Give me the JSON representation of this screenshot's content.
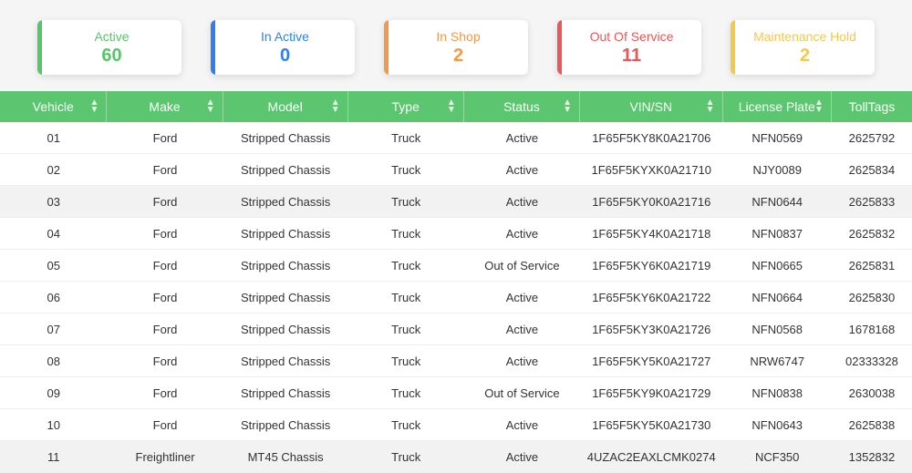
{
  "cards": [
    {
      "label": "Active",
      "value": "60",
      "colorClass": "c-green",
      "barClass": "b-green"
    },
    {
      "label": "In Active",
      "value": "0",
      "colorClass": "c-blue",
      "barClass": "b-blue"
    },
    {
      "label": "In Shop",
      "value": "2",
      "colorClass": "c-orange",
      "barClass": "b-orange"
    },
    {
      "label": "Out Of Service",
      "value": "11",
      "colorClass": "c-red",
      "barClass": "b-red"
    },
    {
      "label": "Maintenance Hold",
      "value": "2",
      "colorClass": "c-yellow",
      "barClass": "b-yellow"
    }
  ],
  "columns": [
    {
      "label": "Vehicle",
      "class": "col-vehicle"
    },
    {
      "label": "Make",
      "class": "col-make"
    },
    {
      "label": "Model",
      "class": "col-model"
    },
    {
      "label": "Type",
      "class": "col-type"
    },
    {
      "label": "Status",
      "class": "col-status"
    },
    {
      "label": "VIN/SN",
      "class": "col-vin"
    },
    {
      "label": "License Plate",
      "class": "col-plate"
    },
    {
      "label": "TollTags",
      "class": "col-toll"
    }
  ],
  "rows": [
    {
      "vehicle": "01",
      "make": "Ford",
      "model": "Stripped Chassis",
      "type": "Truck",
      "status": "Active",
      "vin": "1F65F5KY8K0A21706",
      "plate": "NFN0569",
      "toll": "2625792",
      "alt": false
    },
    {
      "vehicle": "02",
      "make": "Ford",
      "model": "Stripped Chassis",
      "type": "Truck",
      "status": "Active",
      "vin": "1F65F5KYXK0A21710",
      "plate": "NJY0089",
      "toll": "2625834",
      "alt": false
    },
    {
      "vehicle": "03",
      "make": "Ford",
      "model": "Stripped Chassis",
      "type": "Truck",
      "status": "Active",
      "vin": "1F65F5KY0K0A21716",
      "plate": "NFN0644",
      "toll": "2625833",
      "alt": true
    },
    {
      "vehicle": "04",
      "make": "Ford",
      "model": "Stripped Chassis",
      "type": "Truck",
      "status": "Active",
      "vin": "1F65F5KY4K0A21718",
      "plate": "NFN0837",
      "toll": "2625832",
      "alt": false
    },
    {
      "vehicle": "05",
      "make": "Ford",
      "model": "Stripped Chassis",
      "type": "Truck",
      "status": "Out of Service",
      "vin": "1F65F5KY6K0A21719",
      "plate": "NFN0665",
      "toll": "2625831",
      "alt": false
    },
    {
      "vehicle": "06",
      "make": "Ford",
      "model": "Stripped Chassis",
      "type": "Truck",
      "status": "Active",
      "vin": "1F65F5KY6K0A21722",
      "plate": "NFN0664",
      "toll": "2625830",
      "alt": false
    },
    {
      "vehicle": "07",
      "make": "Ford",
      "model": "Stripped Chassis",
      "type": "Truck",
      "status": "Active",
      "vin": "1F65F5KY3K0A21726",
      "plate": "NFN0568",
      "toll": "1678168",
      "alt": false
    },
    {
      "vehicle": "08",
      "make": "Ford",
      "model": "Stripped Chassis",
      "type": "Truck",
      "status": "Active",
      "vin": "1F65F5KY5K0A21727",
      "plate": "NRW6747",
      "toll": "02333328",
      "alt": false
    },
    {
      "vehicle": "09",
      "make": "Ford",
      "model": "Stripped Chassis",
      "type": "Truck",
      "status": "Out of Service",
      "vin": "1F65F5KY9K0A21729",
      "plate": "NFN0838",
      "toll": "2630038",
      "alt": false
    },
    {
      "vehicle": "10",
      "make": "Ford",
      "model": "Stripped Chassis",
      "type": "Truck",
      "status": "Active",
      "vin": "1F65F5KY5K0A21730",
      "plate": "NFN0643",
      "toll": "2625838",
      "alt": false
    },
    {
      "vehicle": "11",
      "make": "Freightliner",
      "model": "MT45 Chassis",
      "type": "Truck",
      "status": "Active",
      "vin": "4UZAC2EAXLCMK0274",
      "plate": "NCF350",
      "toll": "1352832",
      "alt": true
    }
  ]
}
